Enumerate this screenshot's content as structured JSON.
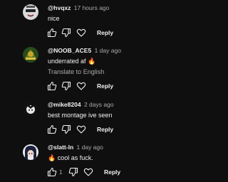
{
  "comments": [
    {
      "author": "@hvqxz",
      "time": "17 hours ago",
      "text": "nice",
      "reply_label": "Reply",
      "avatar": {
        "bg": "#d9d9d9",
        "fg": "#222222",
        "icon": "sunglasses-face-avatar"
      }
    },
    {
      "author": "@NOOB_ACE5",
      "time": "1 day ago",
      "text": "underrated af",
      "emoji": "🔥",
      "translate_label": "Translate to English",
      "reply_label": "Reply",
      "avatar": {
        "bg": "#2a4a1c",
        "fg": "#e2c23a",
        "icon": "game-logo-avatar"
      }
    },
    {
      "author": "@mike8204",
      "time": "2 days ago",
      "text": "best montage ive seen",
      "reply_label": "Reply",
      "avatar": {
        "bg": "#111111",
        "fg": "#e8e8e8",
        "icon": "anime-character-avatar"
      }
    },
    {
      "author": "@slatt-ln",
      "time": "1 day ago",
      "emoji": "🔥",
      "text": "cool as fuck.",
      "like_count": "1",
      "reply_label": "Reply",
      "avatar": {
        "bg": "#e9ecf5",
        "fg": "#1b1f3b",
        "icon": "anime-girl-avatar"
      }
    }
  ]
}
